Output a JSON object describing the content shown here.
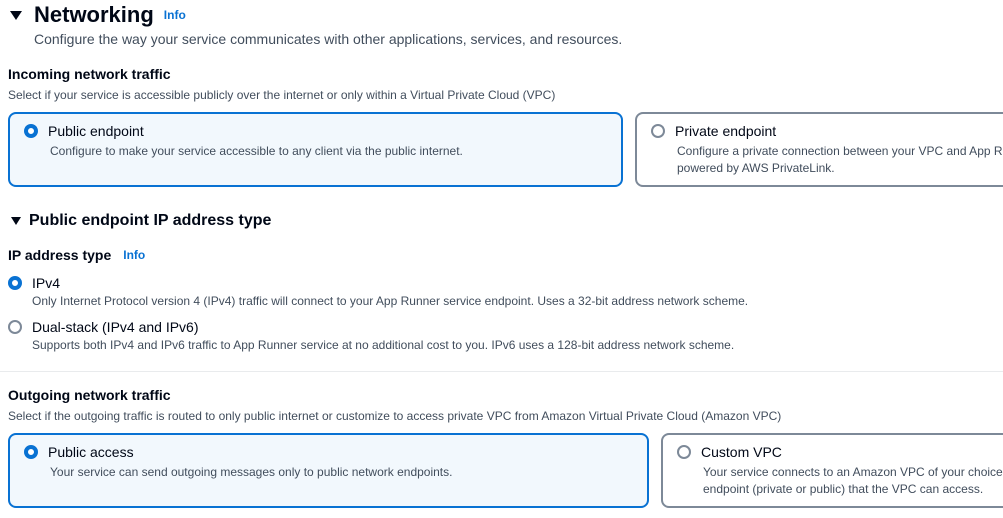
{
  "networking": {
    "title": "Networking",
    "info": "Info",
    "description": "Configure the way your service communicates with other applications, services, and resources."
  },
  "incoming": {
    "label": "Incoming network traffic",
    "description": "Select if your service is accessible publicly over the internet or only within a Virtual Private Cloud (VPC)",
    "options": [
      {
        "title": "Public endpoint",
        "desc1": "Configure to make your service accessible to any client via the public internet.",
        "desc2": "",
        "selected": true
      },
      {
        "title": "Private endpoint",
        "desc1": "Configure a private connection between your VPC and App R",
        "desc2": "powered by AWS PrivateLink.",
        "selected": false
      }
    ]
  },
  "public_endpoint_ip": {
    "title": "Public endpoint IP address type",
    "field_label": "IP address type",
    "info": "Info",
    "options": [
      {
        "label": "IPv4",
        "desc": "Only Internet Protocol version 4 (IPv4) traffic will connect to your App Runner service endpoint. Uses a 32-bit address network scheme.",
        "selected": true
      },
      {
        "label": "Dual-stack (IPv4 and IPv6)",
        "desc": "Supports both IPv4 and IPv6 traffic to App Runner service at no additional cost to you. IPv6 uses a 128-bit address network scheme.",
        "selected": false
      }
    ]
  },
  "outgoing": {
    "label": "Outgoing network traffic",
    "description": "Select if the outgoing traffic is routed to only public internet or customize to access private VPC from Amazon Virtual Private Cloud (Amazon VPC)",
    "options": [
      {
        "title": "Public access",
        "desc1": "Your service can send outgoing messages only to public network endpoints.",
        "desc2": "",
        "selected": true
      },
      {
        "title": "Custom VPC",
        "desc1": "Your service connects to an Amazon VPC of your choice",
        "desc2": "endpoint (private or public) that the VPC can access.",
        "selected": false
      }
    ]
  },
  "colors": {
    "accent": "#0972d3",
    "selected_tile_bg": "#f2f8fd",
    "border": "#7d8998",
    "text": "#000716",
    "secondary_text": "#414d5c"
  }
}
